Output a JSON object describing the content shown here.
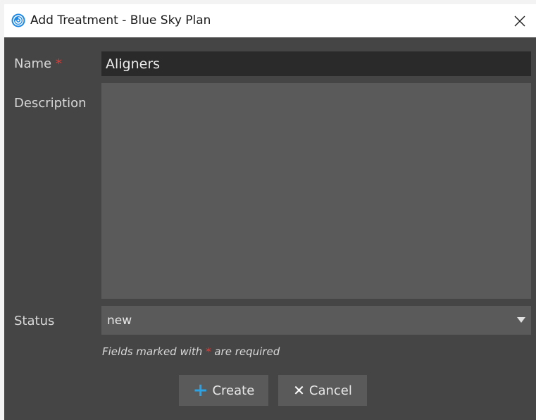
{
  "window": {
    "title": "Add Treatment - Blue Sky Plan",
    "close_glyph": "✕",
    "app_icon": "blue-sky-plan-icon"
  },
  "form": {
    "name_label": "Name",
    "required_mark": "*",
    "name_value": "Aligners",
    "description_label": "Description",
    "description_value": "",
    "status_label": "Status",
    "status_value": "new",
    "hint_prefix": "Fields marked with ",
    "hint_mark": "*",
    "hint_suffix": " are required"
  },
  "buttons": {
    "create_label": "Create",
    "create_icon": "+",
    "cancel_label": "Cancel",
    "cancel_icon": "✕"
  },
  "colors": {
    "background": "#454545",
    "input_dark": "#2a2a2a",
    "input": "#5a5a5a",
    "required": "#e53935",
    "accent": "#29a3e6"
  }
}
